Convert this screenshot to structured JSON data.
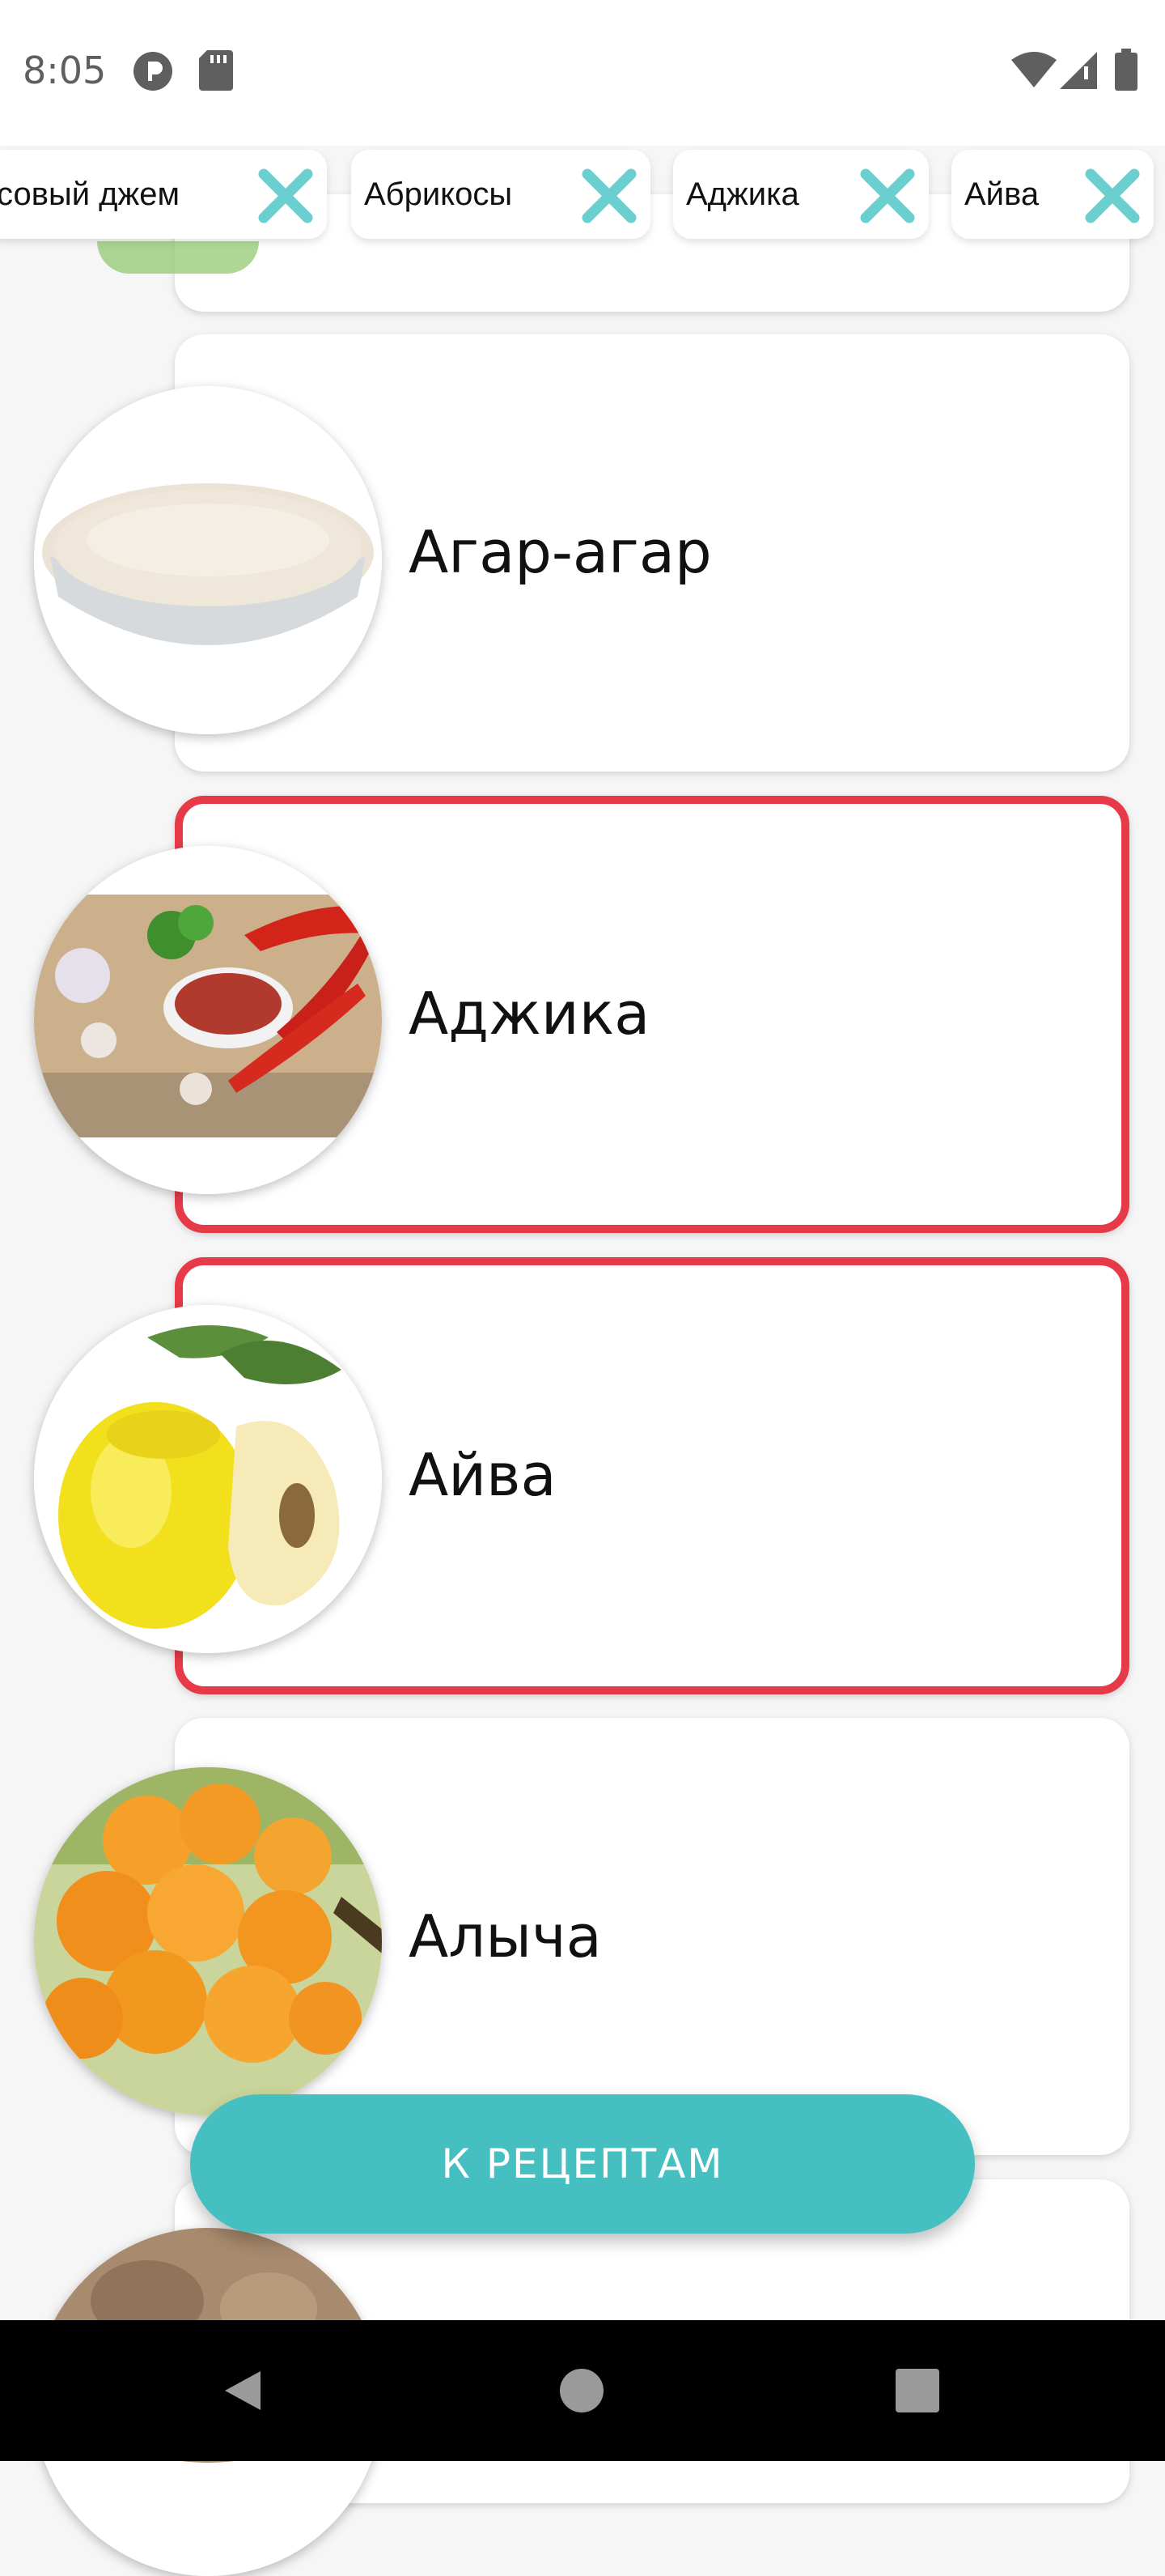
{
  "status_bar": {
    "time": "8:05"
  },
  "selected_chips": [
    {
      "label": "совый джем"
    },
    {
      "label": "Абрикосы"
    },
    {
      "label": "Аджика"
    },
    {
      "label": "Айва"
    }
  ],
  "products": [
    {
      "name": "Агар-агар",
      "selected": false,
      "image": "agar-powder-bowl"
    },
    {
      "name": "Аджика",
      "selected": true,
      "image": "adjika-peppers-bowl"
    },
    {
      "name": "Айва",
      "selected": true,
      "image": "quince-fruit"
    },
    {
      "name": "Алыча",
      "selected": false,
      "image": "cherry-plum-fruit"
    }
  ],
  "action_button": {
    "label": "К РЕЦЕПТАМ"
  },
  "colors": {
    "accent": "#46bfc1",
    "selected_border": "#e63a49",
    "chip_x": "#6ccfcf"
  },
  "nav_bar": {
    "icons": [
      "back-icon",
      "home-icon",
      "recents-icon"
    ]
  }
}
